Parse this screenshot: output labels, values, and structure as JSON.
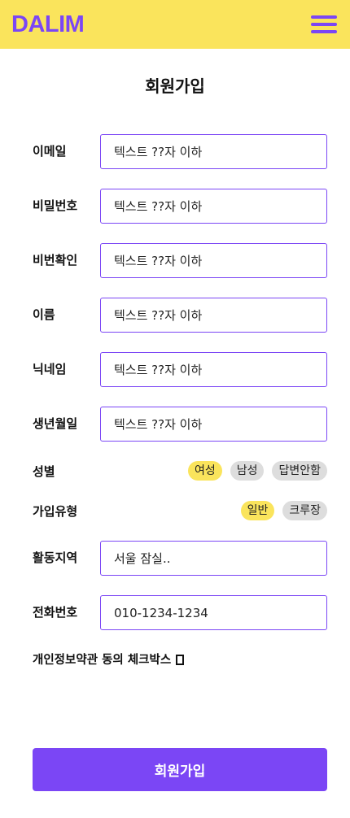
{
  "header": {
    "logo": "DALIM",
    "menu_icon": "hamburger-menu-icon"
  },
  "page_title": "회원가입",
  "fields": [
    {
      "label": "이메일",
      "value": "",
      "placeholder": "텍스트 ??자 이하"
    },
    {
      "label": "비밀번호",
      "value": "",
      "placeholder": "텍스트 ??자 이하"
    },
    {
      "label": "비번확인",
      "value": "",
      "placeholder": "텍스트 ??자 이하"
    },
    {
      "label": "이름",
      "value": "",
      "placeholder": "텍스트 ??자 이하"
    },
    {
      "label": "닉네임",
      "value": "",
      "placeholder": "텍스트 ??자 이하"
    },
    {
      "label": "생년월일",
      "value": "",
      "placeholder": "텍스트 ??자 이하"
    }
  ],
  "gender": {
    "label": "성별",
    "options": [
      "여성",
      "남성",
      "답변안함"
    ],
    "selected": "여성"
  },
  "join_type": {
    "label": "가입유형",
    "options": [
      "일반",
      "크루장"
    ],
    "selected": "일반"
  },
  "region": {
    "label": "활동지역",
    "value": "",
    "placeholder": "서울 잠실.."
  },
  "phone": {
    "label": "전화번호",
    "value": "",
    "placeholder": "010-1234-1234"
  },
  "consent": {
    "label": "개인정보약관 동의 체크박스",
    "checked": false
  },
  "submit_label": "회원가입",
  "colors": {
    "brand_purple": "#7b46f5",
    "brand_yellow": "#fae45c",
    "chip_gray": "#dddddd"
  }
}
